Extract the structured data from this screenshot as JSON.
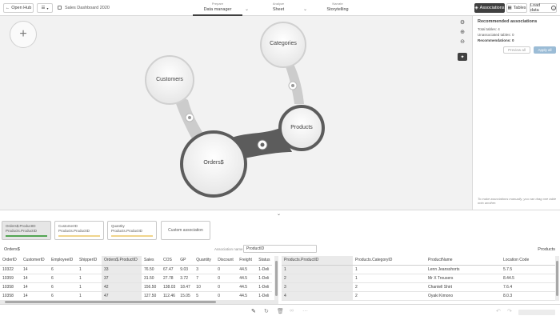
{
  "topbar": {
    "open_hub": "Open Hub",
    "app_title": "Sales Dashboard 2020",
    "nav": [
      {
        "small": "Prepare",
        "big": "Data manager"
      },
      {
        "small": "Analyze",
        "big": "Sheet"
      },
      {
        "small": "Narrate",
        "big": "Storytelling"
      }
    ],
    "associations_btn": "Associations",
    "tables_btn": "Tables",
    "load_data_btn": "Load data"
  },
  "canvas": {
    "add_symbol": "+",
    "bubbles": {
      "customers": "Customers",
      "categories": "Categories",
      "products": "Products",
      "orders": "Orders$"
    }
  },
  "panel": {
    "title": "Recommended associations",
    "total_tables": "Total tables: 4",
    "unassociated": "Unassociated tables: 0",
    "recommendations": "Recommendations: 0",
    "preview_all": "Preview all",
    "apply_all": "Apply all",
    "hint": "To make associations manually, you can drag one table onto another."
  },
  "cards": [
    {
      "line1": "Orders$.ProductID",
      "line2": "Products.ProductID",
      "bar_color": "#52a552",
      "selected": true
    },
    {
      "line1": "CustomerID",
      "line2": "Products.ProductID",
      "bar_color": "#f0d58c",
      "selected": false
    },
    {
      "line1": "Quantity",
      "line2": "Products.ProductID",
      "bar_color": "#f0d58c",
      "selected": false
    },
    {
      "line1": "Custom association",
      "line2": "",
      "bar_color": "",
      "selected": false
    }
  ],
  "assoc": {
    "left_table": "Orders$",
    "name_label": "Association name",
    "name_value": "ProductID",
    "right_table": "Products"
  },
  "left_table": {
    "headers": [
      "OrderID",
      "CustomerID",
      "EmployeeID",
      "ShipperID",
      "Orders$.ProductID",
      "Sales",
      "COS",
      "GP",
      "Quantity",
      "Discount",
      "Freight",
      "Status"
    ],
    "rows": [
      [
        "10322",
        "14",
        "6",
        "1",
        "33",
        "76.50",
        "67.47",
        "9.03",
        "3",
        "0",
        "44.5",
        "1-Deli"
      ],
      [
        "10359",
        "14",
        "6",
        "1",
        "37",
        "31.50",
        "27.78",
        "3.72",
        "7",
        "0",
        "44.5",
        "1-Deli"
      ],
      [
        "10358",
        "14",
        "6",
        "1",
        "42",
        "156.50",
        "138.03",
        "18.47",
        "10",
        "0",
        "44.5",
        "1-Deli"
      ],
      [
        "10358",
        "14",
        "6",
        "1",
        "47",
        "127.50",
        "112.46",
        "15.05",
        "5",
        "0",
        "44.5",
        "1-Deli"
      ]
    ]
  },
  "right_table": {
    "headers": [
      "Products.ProductID",
      "Products.CategoryID",
      "ProductName",
      "Location Code"
    ],
    "rows": [
      [
        "1",
        "1",
        "Lenn Jeansshorts",
        "5.7.5"
      ],
      [
        "2",
        "1",
        "Mr X Trousers",
        "8.44.5"
      ],
      [
        "3",
        "2",
        "Chantell Shirt",
        "7.6.4"
      ],
      [
        "4",
        "2",
        "Oyaki Kimono",
        "8.0.3"
      ]
    ]
  }
}
